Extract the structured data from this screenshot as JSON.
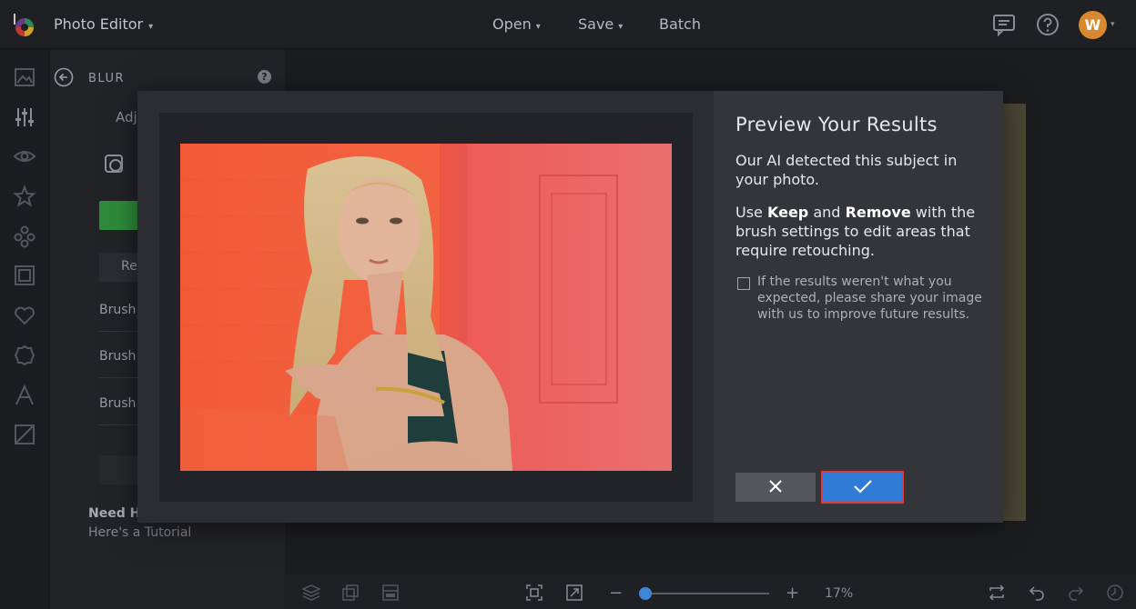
{
  "header": {
    "app_title": "Photo Editor",
    "menu": {
      "open": "Open",
      "save": "Save",
      "batch": "Batch"
    },
    "avatar_initial": "W"
  },
  "rail": {
    "icons": [
      "image-icon",
      "sliders-icon",
      "eye-icon",
      "star-icon",
      "shapes-icon",
      "frame-icon",
      "heart-icon",
      "badge-icon",
      "text-icon",
      "texture-icon"
    ]
  },
  "panel": {
    "title": "BLUR",
    "help": "?",
    "adjust_label": "Adj",
    "reset_label": "Re",
    "brush_rows": [
      "Brush",
      "Brush",
      "Brush"
    ],
    "need_help": "Need He",
    "tutorial": "Here's a Tutorial"
  },
  "bottombar": {
    "zoom_value": "17%",
    "zoom_minus": "−",
    "zoom_plus": "+",
    "zoom_fraction": 0.17
  },
  "modal": {
    "title": "Preview Your Results",
    "paragraph1": "Our AI detected this subject in your photo.",
    "paragraph2": {
      "prefix": "Use",
      "keep": "Keep",
      "and": "and",
      "remove": "Remove",
      "suffix": "with the brush settings to edit areas that require retouching."
    },
    "feedback_note": "If the results weren't what you expected, please share your image with us to improve future results.",
    "feedback_checked": false,
    "cancel_icon": "close-icon",
    "confirm_icon": "checkmark-icon"
  },
  "colors": {
    "accent": "#2f7bd6",
    "highlight_border": "#e53935",
    "avatar": "#d8892f",
    "photo_background": "#f26a4f"
  }
}
